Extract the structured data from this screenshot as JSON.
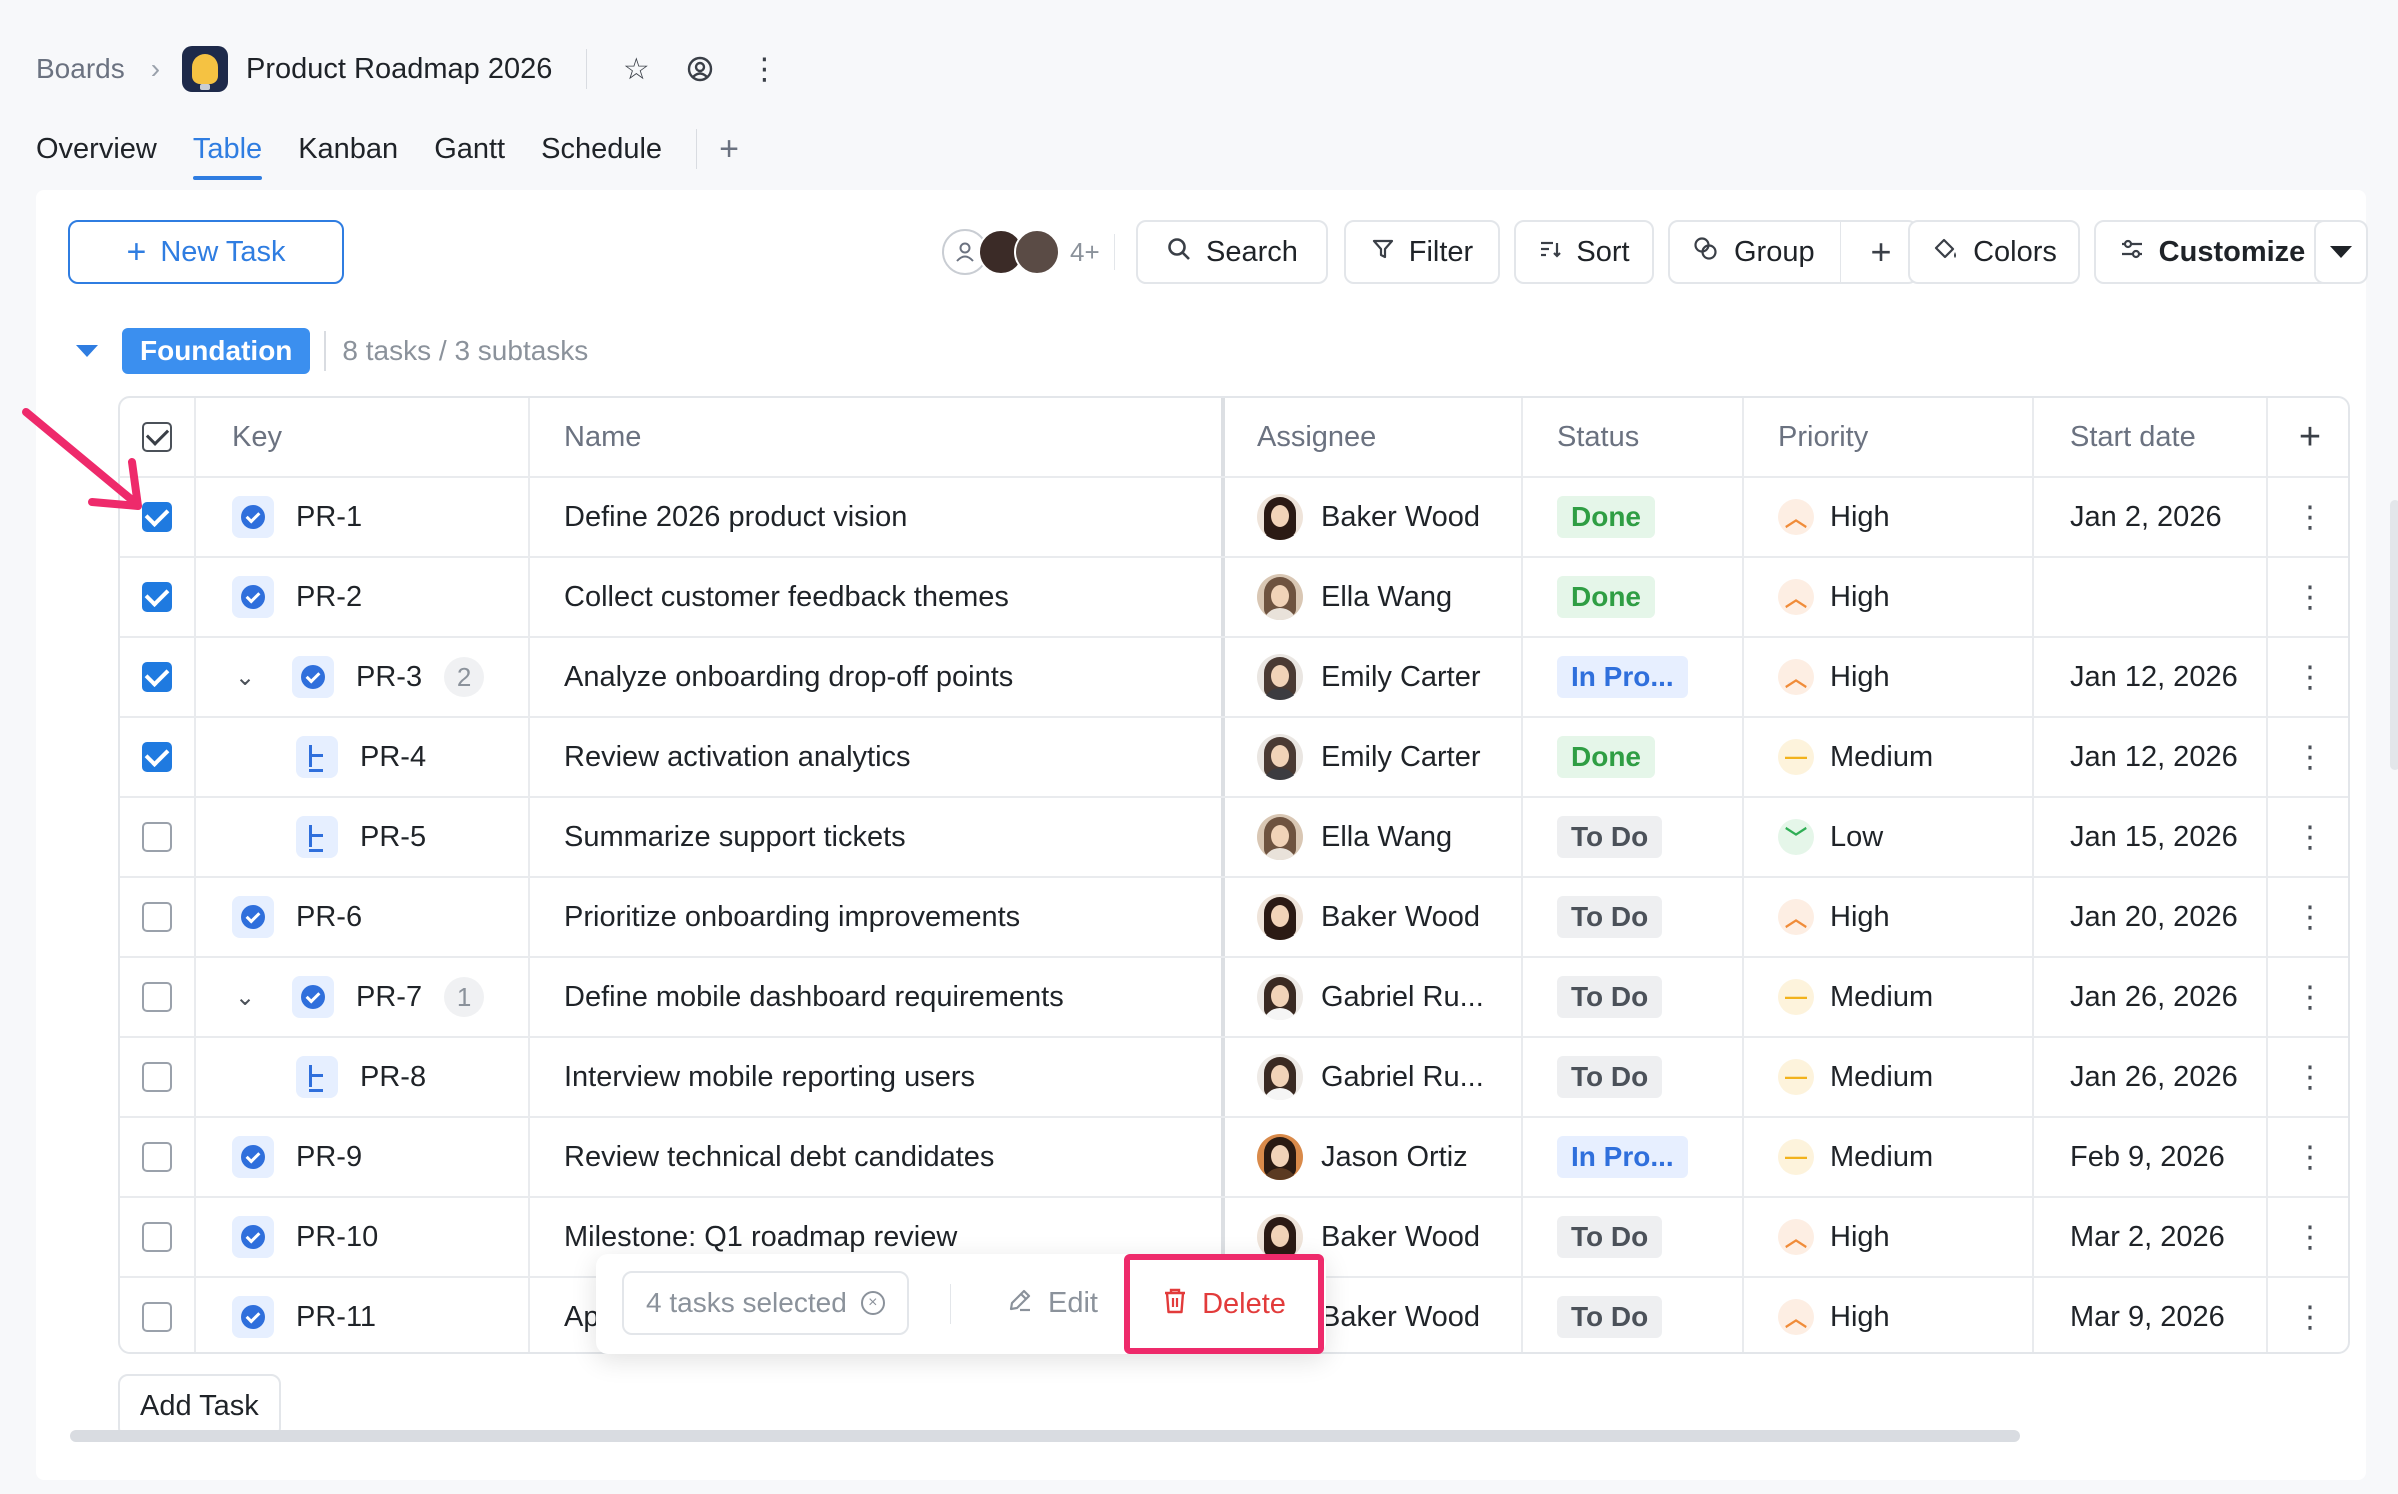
{
  "breadcrumb": {
    "root": "Boards",
    "board_title": "Product Roadmap 2026"
  },
  "header_icons": [
    "star-icon",
    "watch-icon",
    "more-vertical-icon"
  ],
  "tabs": [
    {
      "label": "Overview",
      "active": false
    },
    {
      "label": "Table",
      "active": true
    },
    {
      "label": "Kanban",
      "active": false
    },
    {
      "label": "Gantt",
      "active": false
    },
    {
      "label": "Schedule",
      "active": false
    }
  ],
  "toolbar": {
    "new_task": "New Task",
    "avatars_more": "4+",
    "search": "Search",
    "filter": "Filter",
    "sort": "Sort",
    "group": "Group",
    "colors": "Colors",
    "customize": "Customize"
  },
  "group": {
    "name": "Foundation",
    "count": "8 tasks / 3 subtasks"
  },
  "columns": {
    "key": "Key",
    "name": "Name",
    "assignee": "Assignee",
    "status": "Status",
    "priority": "Priority",
    "start": "Start date"
  },
  "rows": [
    {
      "checked": true,
      "key": "PR-1",
      "type": "task",
      "expand": false,
      "subcount": "",
      "name": "Define 2026 product vision",
      "assignee": "Baker Wood",
      "avatar": "baker",
      "status": "Done",
      "status_kind": "done",
      "priority": "High",
      "priority_kind": "high",
      "start": "Jan 2, 2026"
    },
    {
      "checked": true,
      "key": "PR-2",
      "type": "task",
      "expand": false,
      "subcount": "",
      "name": "Collect customer feedback themes",
      "assignee": "Ella Wang",
      "avatar": "ella",
      "status": "Done",
      "status_kind": "done",
      "priority": "High",
      "priority_kind": "high",
      "start": ""
    },
    {
      "checked": true,
      "key": "PR-3",
      "type": "task",
      "expand": true,
      "subcount": "2",
      "name": "Analyze onboarding drop-off points",
      "assignee": "Emily Carter",
      "avatar": "emily",
      "status": "In Pro...",
      "status_kind": "prog",
      "priority": "High",
      "priority_kind": "high",
      "start": "Jan 12, 2026"
    },
    {
      "checked": true,
      "key": "PR-4",
      "type": "subtask",
      "expand": false,
      "subcount": "",
      "name": "Review activation analytics",
      "assignee": "Emily Carter",
      "avatar": "emily",
      "status": "Done",
      "status_kind": "done",
      "priority": "Medium",
      "priority_kind": "med",
      "start": "Jan 12, 2026"
    },
    {
      "checked": false,
      "key": "PR-5",
      "type": "subtask",
      "expand": false,
      "subcount": "",
      "name": "Summarize support tickets",
      "assignee": "Ella Wang",
      "avatar": "ella",
      "status": "To Do",
      "status_kind": "todo",
      "priority": "Low",
      "priority_kind": "low",
      "start": "Jan 15, 2026"
    },
    {
      "checked": false,
      "key": "PR-6",
      "type": "task",
      "expand": false,
      "subcount": "",
      "name": "Prioritize onboarding improvements",
      "assignee": "Baker Wood",
      "avatar": "baker",
      "status": "To Do",
      "status_kind": "todo",
      "priority": "High",
      "priority_kind": "high",
      "start": "Jan 20, 2026"
    },
    {
      "checked": false,
      "key": "PR-7",
      "type": "task",
      "expand": true,
      "subcount": "1",
      "name": "Define mobile dashboard requirements",
      "assignee": "Gabriel Ru...",
      "avatar": "gabriel",
      "status": "To Do",
      "status_kind": "todo",
      "priority": "Medium",
      "priority_kind": "med",
      "start": "Jan 26, 2026"
    },
    {
      "checked": false,
      "key": "PR-8",
      "type": "subtask",
      "expand": false,
      "subcount": "",
      "name": "Interview mobile reporting users",
      "assignee": "Gabriel Ru...",
      "avatar": "gabriel",
      "status": "To Do",
      "status_kind": "todo",
      "priority": "Medium",
      "priority_kind": "med",
      "start": "Jan 26, 2026"
    },
    {
      "checked": false,
      "key": "PR-9",
      "type": "task",
      "expand": false,
      "subcount": "",
      "name": "Review technical debt candidates",
      "assignee": "Jason Ortiz",
      "avatar": "jason",
      "status": "In Pro...",
      "status_kind": "prog",
      "priority": "Medium",
      "priority_kind": "med",
      "start": "Feb 9, 2026"
    },
    {
      "checked": false,
      "key": "PR-10",
      "type": "task",
      "expand": false,
      "subcount": "",
      "name": "Milestone: Q1 roadmap review",
      "assignee": "Baker Wood",
      "avatar": "baker",
      "status": "To Do",
      "status_kind": "todo",
      "priority": "High",
      "priority_kind": "high",
      "start": "Mar 2, 2026"
    },
    {
      "checked": false,
      "key": "PR-11",
      "type": "task",
      "expand": false,
      "subcount": "",
      "name": "Ap",
      "assignee": "Baker Wood",
      "avatar": "baker",
      "status": "To Do",
      "status_kind": "todo",
      "priority": "High",
      "priority_kind": "high",
      "start": "Mar 9, 2026"
    }
  ],
  "selection_bar": {
    "count": "4 tasks selected",
    "edit": "Edit",
    "delete": "Delete"
  },
  "add_task": "Add Task",
  "colors": {
    "accent": "#2f7de1",
    "highlight": "#ee2a6b",
    "done": "#2f9e44",
    "in_progress": "#2f6fdc"
  }
}
